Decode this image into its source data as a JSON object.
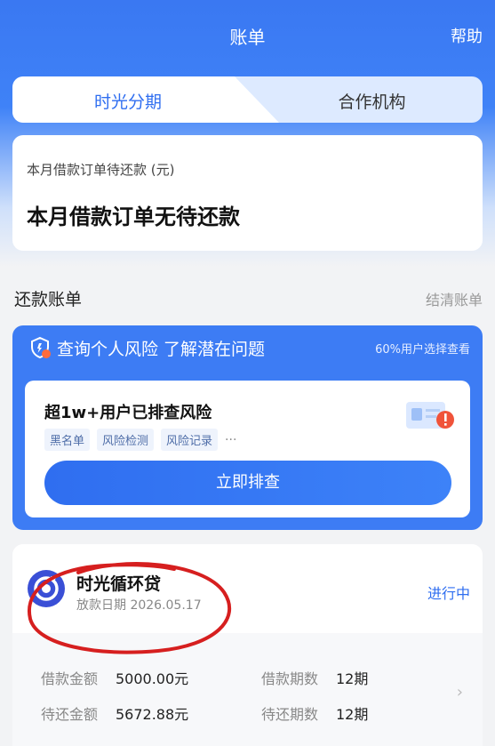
{
  "header": {
    "title": "账单",
    "help_label": "帮助"
  },
  "tabs": [
    {
      "label": "时光分期",
      "active": true
    },
    {
      "label": "合作机构",
      "active": false
    }
  ],
  "monthly": {
    "label": "本月借款订单待还款 (元)",
    "value": "本月借款订单无待还款"
  },
  "repay_section": {
    "title": "还款账单",
    "link": "结清账单"
  },
  "risk": {
    "title": "查询个人风险 了解潜在问题",
    "hint": "60%用户选择查看",
    "headline": "超1w+用户已排查风险",
    "tags": [
      "黑名单",
      "风险检测",
      "风险记录"
    ],
    "more": "···",
    "button": "立即排查",
    "icon_shield": "shield-icon",
    "icon_illustration": "id-card-warning-icon"
  },
  "loan": {
    "name": "时光循环贷",
    "date": "放款日期 2026.05.17",
    "status": "进行中",
    "details": {
      "amount_label": "借款金额",
      "amount_value": "5000.00元",
      "term_label": "借款期数",
      "term_value": "12期",
      "due_label": "待还金额",
      "due_value": "5672.88元",
      "due_term_label": "待还期数",
      "due_term_value": "12期"
    },
    "chevron": "chevron-right-icon"
  },
  "colors": {
    "brand": "#2f6ef0",
    "header_blue": "#3a78f2",
    "annotation_red": "#d61f1f"
  }
}
